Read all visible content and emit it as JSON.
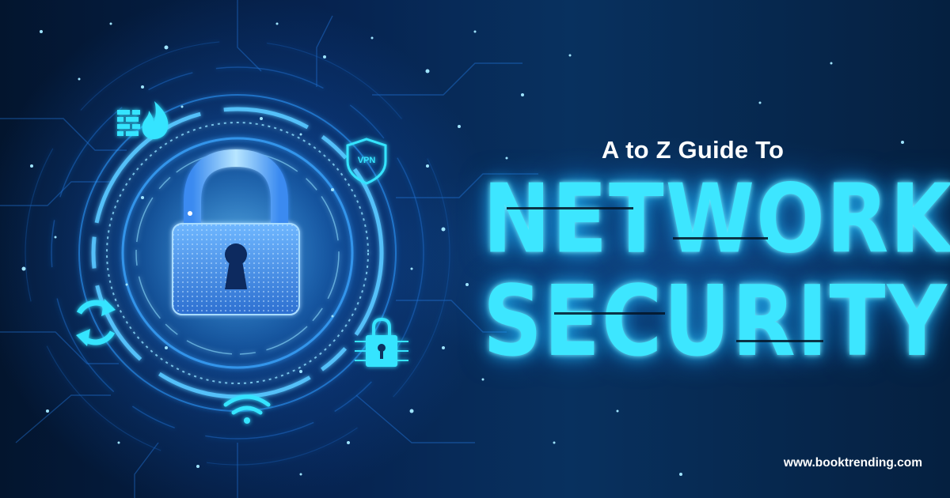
{
  "banner": {
    "kicker": "A to Z Guide To",
    "title_line1": "NETWORK",
    "title_line2": "SECURITY",
    "website": "www.booktrending.com"
  },
  "icons": {
    "vpn_label": "VPN",
    "names": [
      "padlock-icon",
      "firewall-icon",
      "vpn-shield-icon",
      "sync-icon",
      "wifi-icon",
      "chip-lock-icon"
    ]
  },
  "colors": {
    "background_dark": "#041426",
    "background_mid": "#08315f",
    "glow_cyan": "#3de6ff",
    "text_white": "#ffffff"
  }
}
